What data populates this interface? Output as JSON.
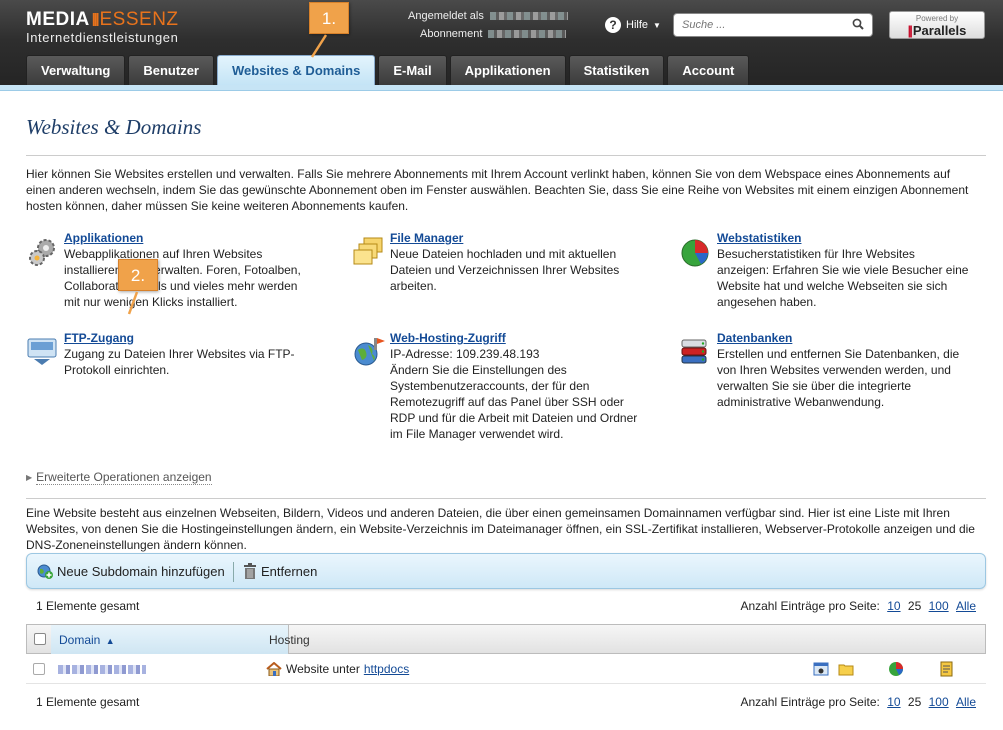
{
  "header": {
    "brand_left": "MEDIA",
    "brand_sep": "|||",
    "brand_right": "ESSENZ",
    "tagline": "Internetdienstleistungen",
    "logged_in_label": "Angemeldet als",
    "subscription_label": "Abonnement",
    "help_label": "Hilfe",
    "search_placeholder": "Suche ...",
    "powered_by": "Powered by",
    "parallels": "Parallels"
  },
  "tabs": [
    {
      "label": "Verwaltung",
      "active": false
    },
    {
      "label": "Benutzer",
      "active": false
    },
    {
      "label": "Websites & Domains",
      "active": true
    },
    {
      "label": "E-Mail",
      "active": false
    },
    {
      "label": "Applikationen",
      "active": false
    },
    {
      "label": "Statistiken",
      "active": false
    },
    {
      "label": "Account",
      "active": false
    }
  ],
  "callouts": [
    "1.",
    "2."
  ],
  "page": {
    "title": "Websites & Domains",
    "intro": "Hier können Sie Websites erstellen und verwalten. Falls Sie mehrere Abonnements mit Ihrem Account verlinkt haben, können Sie von dem Webspace eines Abonnements auf einen anderen wechseln, indem Sie das gewünschte Abonnement oben im Fenster auswählen. Beachten Sie, dass Sie eine Reihe von Websites mit einem einzigen Abonnement hosten können, daher müssen Sie keine weiteren Abonnements kaufen."
  },
  "tools": [
    {
      "title": "Applikationen",
      "text": "Webapplikationen auf Ihren Websites installieren und verwalten. Foren, Fotoalben, Collaboration-Tools und vieles mehr werden mit nur wenigen Klicks installiert.",
      "icon": "gears-icon"
    },
    {
      "title": "File Manager",
      "text": "Neue Dateien hochladen und mit aktuellen Dateien und Verzeichnissen Ihrer Websites arbeiten.",
      "icon": "folders-icon"
    },
    {
      "title": "Webstatistiken",
      "text": "Besucherstatistiken für Ihre Websites anzeigen: Erfahren Sie wie viele Besucher eine Website hat und welche Webseiten sie sich angesehen haben.",
      "icon": "pie-chart-icon"
    },
    {
      "title": "FTP-Zugang",
      "text": "Zugang zu Dateien Ihrer Websites via FTP-Protokoll einrichten.",
      "icon": "ftp-icon"
    },
    {
      "title": "Web-Hosting-Zugriff",
      "text": "IP-Adresse: 109.239.48.193\nÄndern Sie die Einstellungen des Systembenutzeraccounts, der für den Remotezugriff auf das Panel über SSH oder RDP und für die Arbeit mit Dateien und Ordner im File Manager verwendet wird.",
      "icon": "globe-icon"
    },
    {
      "title": "Datenbanken",
      "text": "Erstellen und entfernen Sie Datenbanken, die von Ihren Websites verwenden werden, und verwalten Sie sie über die integrierte administrative Webanwendung.",
      "icon": "database-icon"
    }
  ],
  "advanced_link": "Erweiterte Operationen anzeigen",
  "sites_description": "Eine Website besteht aus einzelnen Webseiten, Bildern, Videos und anderen Dateien, die über einen gemeinsamen Domainnamen verfügbar sind. Hier ist eine Liste mit Ihren Websites, von denen Sie die Hostingeinstellungen ändern, ein Website-Verzeichnis im Dateimanager öffnen, ein SSL-Zertifikat installieren, Webserver-Protokolle anzeigen und die DNS-Zoneneinstellungen ändern können.",
  "toolbar": {
    "add_subdomain": "Neue Subdomain hinzufügen",
    "remove": "Entfernen"
  },
  "list": {
    "total": "1 Elemente gesamt",
    "per_page_label": "Anzahl Einträge pro Seite:",
    "per_page_options": [
      "10",
      "25",
      "100",
      "Alle"
    ],
    "per_page_selected": "25",
    "col_domain": "Domain",
    "sort_arrow": "▲",
    "col_hosting": "Hosting",
    "rows": [
      {
        "hosting_prefix": "Website unter",
        "hosting_link": "httpdocs"
      }
    ]
  }
}
